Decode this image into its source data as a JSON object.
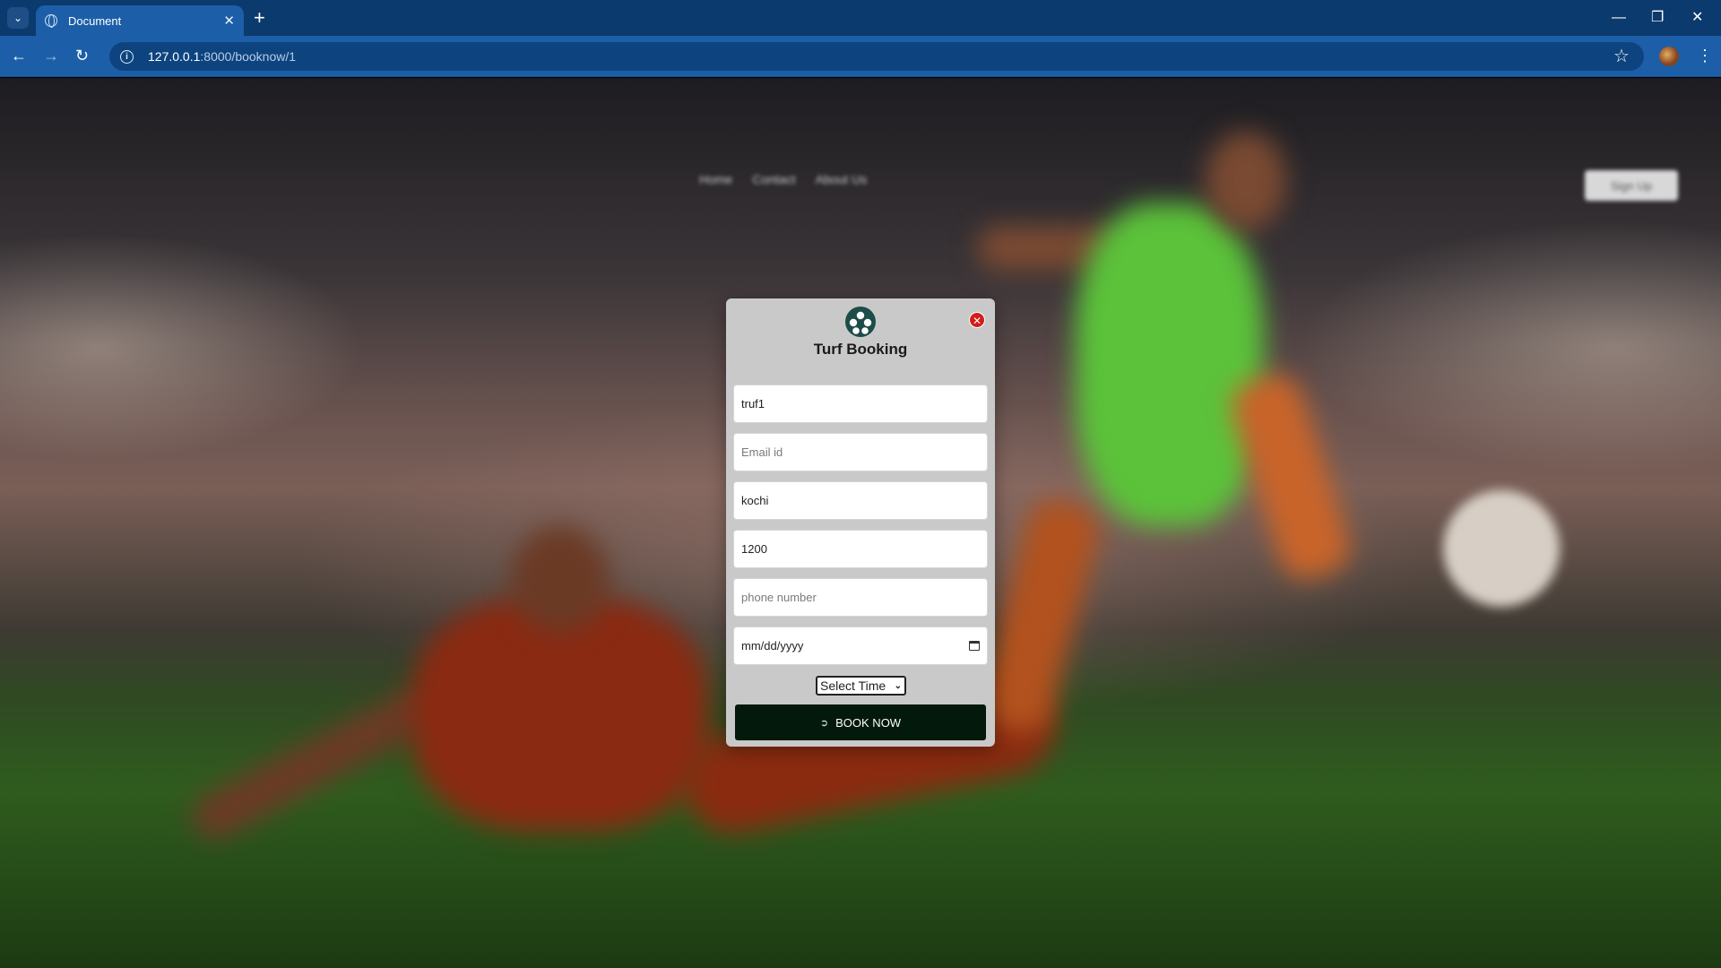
{
  "browser": {
    "tab_title": "Document",
    "new_tab_symbol": "+",
    "url_host": "127.0.0.1",
    "url_path": ":8000/booknow/1",
    "icons": [
      "tab-list-icon",
      "globe-icon",
      "close-tab-icon",
      "new-tab-icon",
      "minimize-icon",
      "restore-icon",
      "close-window-icon",
      "back-icon",
      "forward-icon",
      "reload-icon",
      "site-info-icon",
      "bookmark-star-icon",
      "profile-avatar",
      "menu-kebab-icon"
    ]
  },
  "site": {
    "nav": [
      "Home",
      "Contact",
      "About Us"
    ],
    "signup_label": "Sign Up"
  },
  "modal": {
    "title": "Turf Booking",
    "logo_icon": "soccer-ball-icon",
    "fields": {
      "turf_name": "truf1",
      "email_placeholder": "Email id",
      "location": "kochi",
      "price": "1200",
      "phone_placeholder": "phone number",
      "date_placeholder": "mm/dd/yyyy"
    },
    "time_select": "Select Time",
    "book_button": "BOOK NOW",
    "colors": {
      "close": "#d41c1c",
      "button": "#03190c",
      "logo": "#1d4d48"
    }
  }
}
